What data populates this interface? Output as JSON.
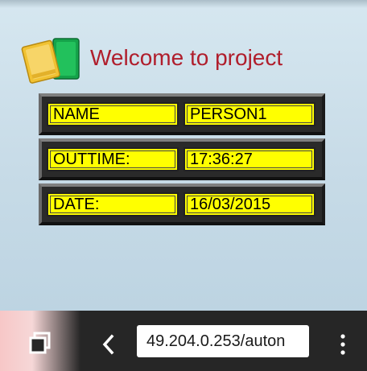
{
  "header": {
    "welcome": "Welcome to project",
    "logo_icon": "book-icon"
  },
  "rows": [
    {
      "label": "NAME",
      "value": "PERSON1"
    },
    {
      "label": "OUTTIME:",
      "value": "17:36:27"
    },
    {
      "label": "DATE:",
      "value": "16/03/2015"
    }
  ],
  "browser": {
    "url": "49.204.0.253/auton",
    "tabs_icon": "tabs-icon",
    "back_icon": "back-chevron-icon",
    "menu_icon": "overflow-menu-icon"
  },
  "colors": {
    "title": "#b01e2c",
    "field_bg": "#ffff00",
    "panel_bg": "#2a2a2a",
    "navbar_bg": "#262626"
  }
}
